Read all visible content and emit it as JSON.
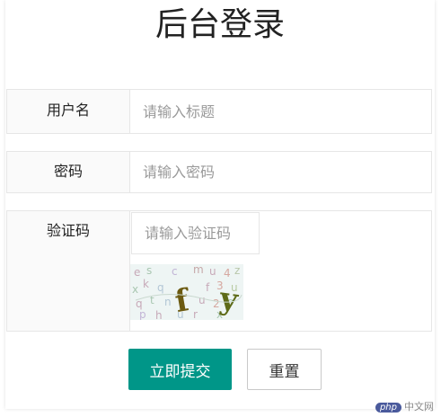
{
  "title": "后台登录",
  "form": {
    "username": {
      "label": "用户名",
      "placeholder": "请输入标题"
    },
    "password": {
      "label": "密码",
      "placeholder": "请输入密码"
    },
    "captcha": {
      "label": "验证码",
      "placeholder": "请输入验证码",
      "image_text": "ffy"
    }
  },
  "buttons": {
    "submit": "立即提交",
    "reset": "重置"
  },
  "watermark": {
    "logo": "php",
    "text": "中文网"
  },
  "colors": {
    "primary": "#009688",
    "label_bg": "#fafafa",
    "border": "#e6e6e6"
  }
}
